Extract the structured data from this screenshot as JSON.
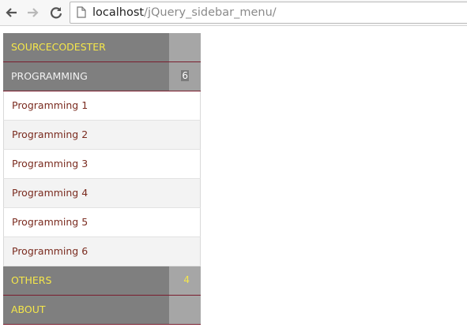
{
  "browser": {
    "url_host": "localhost",
    "url_path": "/jQuery_sidebar_menu/",
    "back_icon": "back-arrow-icon",
    "forward_icon": "forward-arrow-icon",
    "reload_icon": "reload-icon",
    "page_icon": "page-icon"
  },
  "colors": {
    "header_bg": "#7f7f7f",
    "side_bg": "#a6a6a6",
    "header_yellow": "#f5e74a",
    "header_white": "#f2f2f2",
    "divider": "#7a1d2e",
    "submenu_text": "#7a2b1f"
  },
  "sidebar": {
    "items": [
      {
        "label": "SOURCECODESTER",
        "count": ""
      },
      {
        "label": "PROGRAMMING",
        "count": "6",
        "submenu": [
          "Programming 1",
          "Programming 2",
          "Programming 3",
          "Programming 4",
          "Programming 5",
          "Programming 6"
        ]
      },
      {
        "label": "OTHERS",
        "count": "4"
      },
      {
        "label": "ABOUT",
        "count": ""
      }
    ]
  }
}
